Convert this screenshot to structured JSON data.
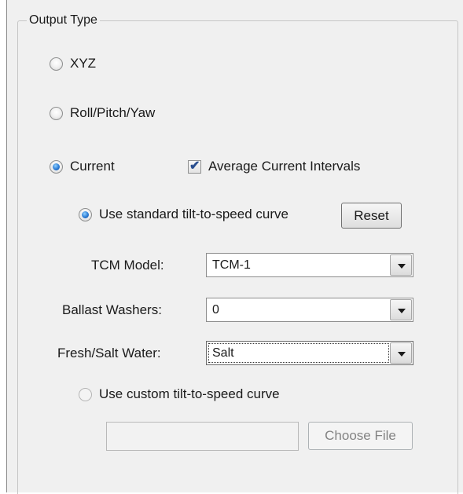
{
  "group": {
    "title": "Output Type"
  },
  "output_options": {
    "xyz": {
      "label": "XYZ",
      "selected": false
    },
    "roll_pitch_yaw": {
      "label": "Roll/Pitch/Yaw",
      "selected": false
    },
    "current": {
      "label": "Current",
      "selected": true
    }
  },
  "average_current_intervals": {
    "label": "Average Current Intervals",
    "checked": true
  },
  "curve": {
    "standard": {
      "label": "Use standard tilt-to-speed curve",
      "selected": true
    },
    "reset_label": "Reset",
    "custom": {
      "label": "Use custom tilt-to-speed curve",
      "selected": false
    },
    "file_path": "",
    "choose_file_label": "Choose File"
  },
  "fields": {
    "tcm_model": {
      "label": "TCM Model:",
      "value": "TCM-1"
    },
    "ballast_washers": {
      "label": "Ballast Washers:",
      "value": "0"
    },
    "water": {
      "label": "Fresh/Salt Water:",
      "value": "Salt"
    }
  },
  "icons": {
    "checkmark": "✔",
    "dropdown": "chevron-down-icon"
  }
}
